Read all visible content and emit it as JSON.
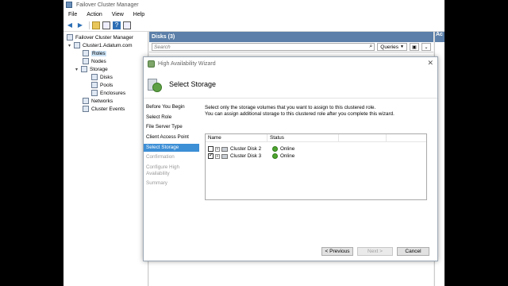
{
  "window": {
    "title": "Failover Cluster Manager"
  },
  "menu": [
    "File",
    "Action",
    "View",
    "Help"
  ],
  "tree": {
    "items": [
      {
        "label": "Failover Cluster Manager",
        "icon": "cluster-manager-icon",
        "level": 0
      },
      {
        "label": "Cluster1.Adatum.com",
        "icon": "cluster-icon",
        "level": 1
      },
      {
        "label": "Roles",
        "icon": "roles-icon",
        "level": 2
      },
      {
        "label": "Nodes",
        "icon": "nodes-icon",
        "level": 2
      },
      {
        "label": "Storage",
        "icon": "storage-icon",
        "level": 2
      },
      {
        "label": "Disks",
        "icon": "disks-icon",
        "level": 3
      },
      {
        "label": "Pools",
        "icon": "pools-icon",
        "level": 3
      },
      {
        "label": "Enclosures",
        "icon": "enclosures-icon",
        "level": 3
      },
      {
        "label": "Networks",
        "icon": "networks-icon",
        "level": 2
      },
      {
        "label": "Cluster Events",
        "icon": "events-icon",
        "level": 2
      }
    ]
  },
  "center": {
    "header": "Disks (3)",
    "search_placeholder": "Search",
    "queries_label": "Queries"
  },
  "actions": {
    "header": "Ac"
  },
  "wizard": {
    "title": "High Availability Wizard",
    "heading": "Select Storage",
    "close_glyph": "✕",
    "steps": [
      {
        "label": "Before You Begin",
        "state": "normal"
      },
      {
        "label": "Select Role",
        "state": "normal"
      },
      {
        "label": "File Server Type",
        "state": "normal"
      },
      {
        "label": "Client Access Point",
        "state": "normal"
      },
      {
        "label": "Select Storage",
        "state": "active"
      },
      {
        "label": "Confirmation",
        "state": "disabled"
      },
      {
        "label": "Configure High Availability",
        "state": "disabled"
      },
      {
        "label": "Summary",
        "state": "disabled"
      }
    ],
    "description_line1": "Select only the storage volumes that you want to assign to this clustered role.",
    "description_line2": "You can assign additional storage to this clustered role after you complete this wizard.",
    "columns": {
      "name": "Name",
      "status": "Status"
    },
    "disks": [
      {
        "name": "Cluster Disk 2",
        "status": "Online",
        "checked": false
      },
      {
        "name": "Cluster Disk 3",
        "status": "Online",
        "checked": true
      }
    ],
    "buttons": {
      "previous": "< Previous",
      "next": "Next >",
      "cancel": "Cancel"
    }
  }
}
